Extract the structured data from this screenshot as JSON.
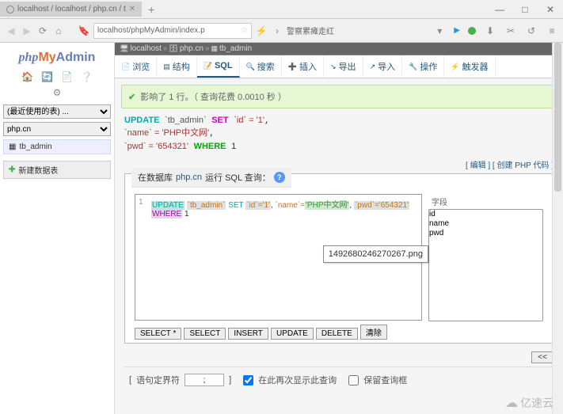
{
  "browser": {
    "tab_title": "localhost / localhost / php.cn / t",
    "url": "localhost/phpMyAdmin/index.p",
    "ext_text": "警察累瘫走红"
  },
  "window": {
    "min": "—",
    "max": "□",
    "close": "✕"
  },
  "logo": {
    "p1": "php",
    "p2": "My",
    "p3": "Admin"
  },
  "sidebar": {
    "select1": "(最近使用的表) ...",
    "select2": "php.cn",
    "table": "tb_admin",
    "newdata": "新建数据表"
  },
  "breadcrumb": {
    "b1": "localhost",
    "b2": "php.cn",
    "b3": "tb_admin"
  },
  "tabs": [
    {
      "ico": "📄",
      "label": "浏览"
    },
    {
      "ico": "▤",
      "label": "结构"
    },
    {
      "ico": "📝",
      "label": "SQL"
    },
    {
      "ico": "🔍",
      "label": "搜索"
    },
    {
      "ico": "➕",
      "label": "插入"
    },
    {
      "ico": "↘",
      "label": "导出"
    },
    {
      "ico": "↗",
      "label": "导入"
    },
    {
      "ico": "🔧",
      "label": "操作"
    },
    {
      "ico": "⚡",
      "label": "触发器"
    }
  ],
  "message": "影响了 1 行。（ 查询花费 0.0010 秒 ）",
  "sql_display": {
    "kw_update": "UPDATE",
    "table": "`tb_admin`",
    "kw_set": "SET",
    "f1": "`id` = '1'",
    "f2": "`name` = 'PHP中文网'",
    "f3": "`pwd` = '654321'",
    "kw_where": "WHERE",
    "where_v": "1"
  },
  "actions": {
    "edit": "编辑",
    "create": "创建 PHP 代码"
  },
  "runhead": {
    "pre": "在数据库",
    "db": "php.cn",
    "post": "运行 SQL 查询："
  },
  "code": {
    "ln": "1",
    "update": "UPDATE",
    "table": "`tb_admin`",
    "set": "SET",
    "f_id": "`id`='1'",
    "c1": ",",
    "f_name_k": "`name`=",
    "f_name_v": "'PHP中文网'",
    "c2": ",",
    "f_pwd": "`pwd`='654321'",
    "where": "WHERE",
    "wv": "1"
  },
  "columns": {
    "heading": "字段",
    "list": [
      "id",
      "name",
      "pwd"
    ]
  },
  "png_overlay": "1492680246270267.png",
  "buttons": {
    "sel_star": "SELECT *",
    "sel": "SELECT",
    "ins": "INSERT",
    "upd": "UPDATE",
    "del": "DELETE",
    "clr": "清除",
    "scroll": "<<"
  },
  "bottom": {
    "delim_label": "语句定界符",
    "delim_val": ";",
    "cb1": "在此再次显示此查询",
    "cb2": "保留查询框"
  },
  "watermark": "亿速云"
}
